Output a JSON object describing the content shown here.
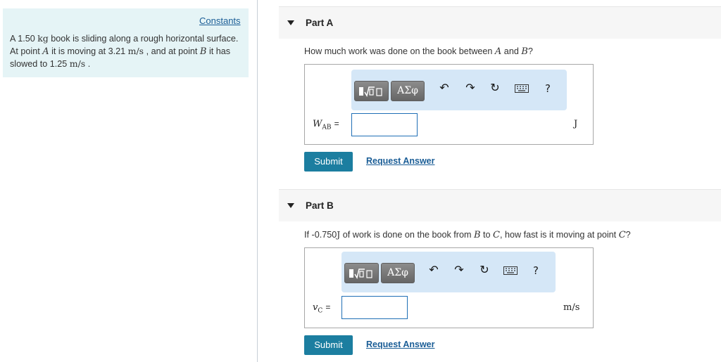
{
  "sidebar": {
    "constants_link": "Constants",
    "problem": {
      "t1": "A 1.50 ",
      "mass_unit": "kg",
      "t2": " book is sliding along a rough horizontal surface. At point ",
      "point_a": "A",
      "t3": " it is moving at 3.21 ",
      "speed_unit_1": "m/s",
      "t4": " , and at point ",
      "point_b": "B",
      "t5": " it has slowed to 1.25 ",
      "speed_unit_2": "m/s",
      "t6": " ."
    }
  },
  "part_a": {
    "label": "Part A",
    "question": {
      "pre": "How much work was done on the book between ",
      "a": "A",
      "mid": " and ",
      "b": "B",
      "post": "?"
    },
    "toolbar": {
      "symbol_btn": "ΑΣφ",
      "help": "?"
    },
    "variable": "W",
    "variable_sub": "AB",
    "equals": "=",
    "input_value": "",
    "unit": "J",
    "submit": "Submit",
    "request": "Request Answer"
  },
  "part_b": {
    "label": "Part B",
    "question": {
      "pre": "If -0.750",
      "joule": "J",
      "mid1": " of work is done on the book from ",
      "b": "B",
      "to": " to ",
      "c": "C",
      "mid2": ", how fast is it moving at point ",
      "c2": "C",
      "post": "?"
    },
    "toolbar": {
      "symbol_btn": "ΑΣφ",
      "help": "?"
    },
    "variable": "v",
    "variable_sub": "C",
    "equals": "=",
    "input_value": "",
    "unit": "m/s",
    "submit": "Submit",
    "request": "Request Answer"
  },
  "icons": [
    "expand-arrow-icon",
    "sqrt-template-icon",
    "undo-icon",
    "redo-icon",
    "reset-icon",
    "keyboard-icon",
    "help-icon"
  ],
  "colors": {
    "accent": "#1c7ea0",
    "link": "#1a5d96",
    "problem_bg": "#e5f4f6",
    "toolbar_bg": "#d5e7f7"
  }
}
